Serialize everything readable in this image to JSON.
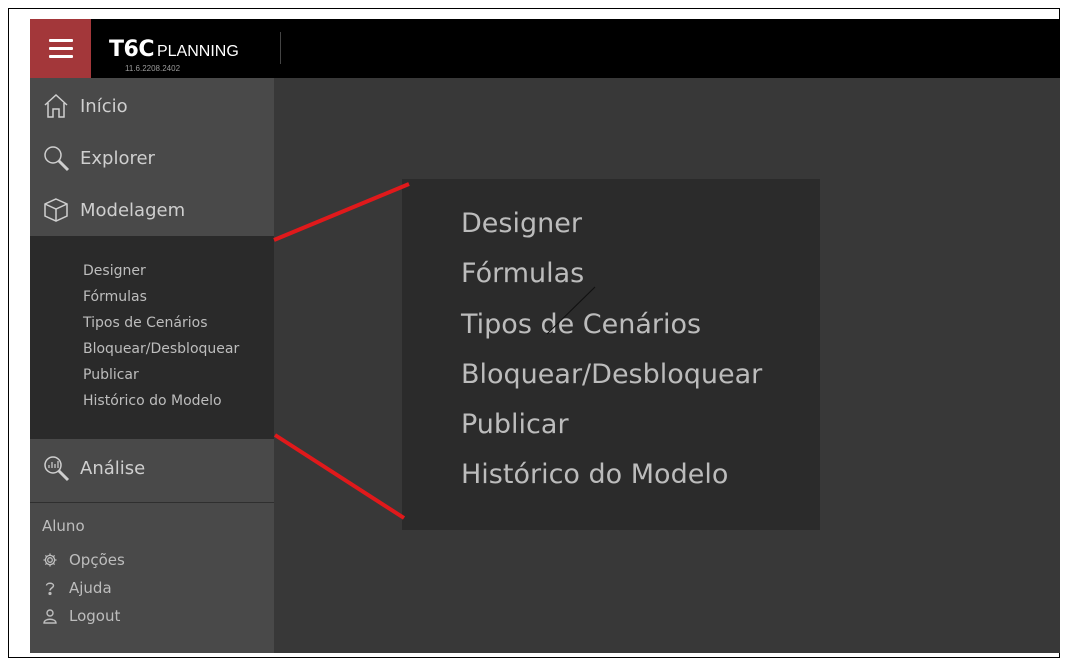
{
  "topbar": {
    "brand_logo": "T6C",
    "brand_suffix": "PLANNING",
    "version": "11.6.2208.2402",
    "menu_icon": "hamburger-icon"
  },
  "sidebar": {
    "nav": [
      {
        "label": "Início",
        "icon": "home-icon"
      },
      {
        "label": "Explorer",
        "icon": "magnifier-icon"
      },
      {
        "label": "Modelagem",
        "icon": "cube-icon"
      },
      {
        "label": "Análise",
        "icon": "analysis-icon"
      }
    ],
    "submenu": [
      "Designer",
      "Fórmulas",
      "Tipos de Cenários",
      "Bloquear/Desbloquear",
      "Publicar",
      "Histórico do Modelo"
    ],
    "user": "Aluno",
    "utility": [
      {
        "label": "Opções",
        "icon": "gear-icon"
      },
      {
        "label": "Ajuda",
        "icon": "help-icon"
      },
      {
        "label": "Logout",
        "icon": "user-icon"
      }
    ]
  },
  "zoom": {
    "items": [
      "Designer",
      "Fórmulas",
      "Tipos de Cenários",
      "Bloquear/Desbloquear",
      "Publicar",
      "Histórico do Modelo"
    ]
  },
  "colors": {
    "menu_button": "#a3373a",
    "callout_line": "#e0191b",
    "sidebar": "#494949",
    "submenu": "#2a2a2a",
    "workspace": "#383838"
  }
}
